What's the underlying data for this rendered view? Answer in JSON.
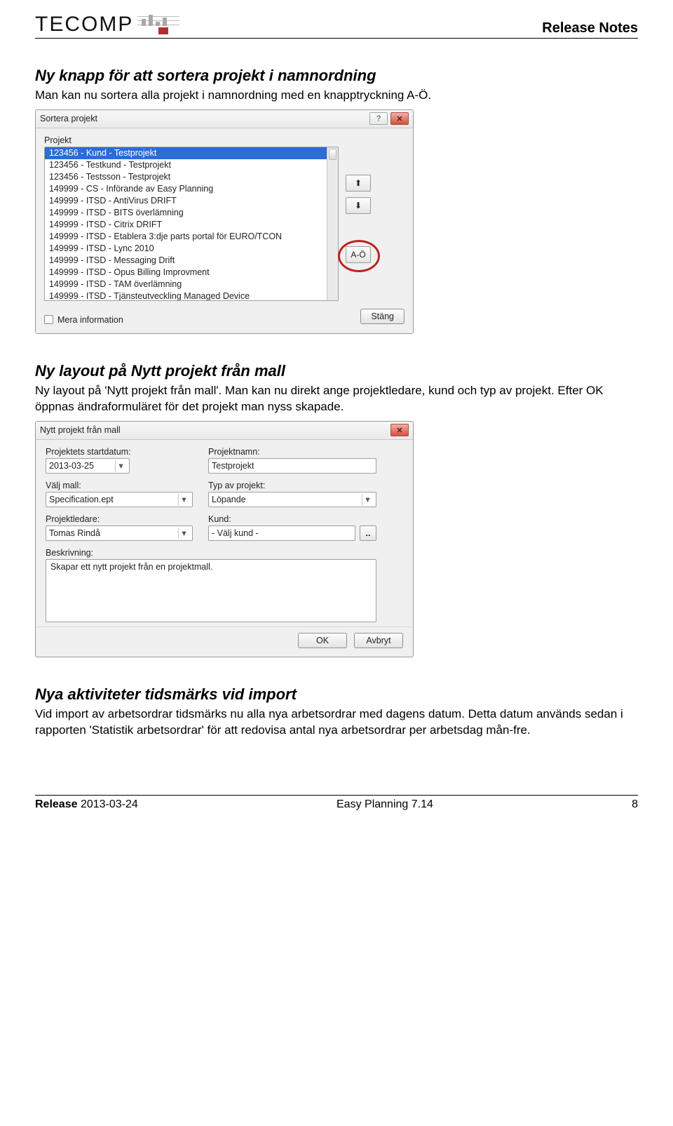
{
  "header": {
    "logo_text": "TECOMP",
    "release_notes": "Release Notes"
  },
  "sections": {
    "s1": {
      "title": "Ny knapp för att sortera projekt i namnordning",
      "body": "Man kan nu sortera alla projekt i namnordning med en knapptryckning A-Ö."
    },
    "s2": {
      "title": "Ny layout på Nytt projekt från mall",
      "body": "Ny layout på 'Nytt projekt från mall'. Man kan nu direkt ange projektledare, kund och typ av projekt. Efter OK öppnas ändraformuläret för det projekt man nyss skapade."
    },
    "s3": {
      "title": "Nya aktiviteter tidsmärks vid import",
      "body": "Vid import av arbetsordrar tidsmärks nu alla nya arbetsordrar med dagens datum. Detta datum används sedan i rapporten 'Statistik arbetsordrar' för att redovisa antal nya arbetsordrar per arbetsdag mån-fre."
    }
  },
  "sort_dialog": {
    "title": "Sortera projekt",
    "group_label": "Projekt",
    "items": [
      "123456 - Kund - Testprojekt",
      "123456 - Testkund - Testprojekt",
      "123456 - Testsson - Testprojekt",
      "149999 - CS - Införande av Easy Planning",
      "149999 - ITSD - AntiVirus DRIFT",
      "149999 - ITSD - BITS överlämning",
      "149999 - ITSD - Citrix DRIFT",
      "149999 - ITSD - Etablera 3:dje parts portal för EURO/TCON",
      "149999 - ITSD - Lync 2010",
      "149999 - ITSD - Messaging Drift",
      "149999 - ITSD - Opus Billing Improvment",
      "149999 - ITSD - TAM överlämning",
      "149999 - ITSD - Tjänsteutveckling Managed Device"
    ],
    "btn_up": "⬆",
    "btn_down": "⬇",
    "btn_azo": "A-Ö",
    "chk_more_info": "Mera information",
    "btn_close": "Stäng",
    "help_icon": "?",
    "close_icon": "✕"
  },
  "new_project_dialog": {
    "title": "Nytt projekt från mall",
    "close_icon": "✕",
    "fields": {
      "start_label": "Projektets startdatum:",
      "start_value": "2013-03-25",
      "name_label": "Projektnamn:",
      "name_value": "Testprojekt",
      "mall_label": "Välj mall:",
      "mall_value": "Specification.ept",
      "typ_label": "Typ av projekt:",
      "typ_value": "Löpande",
      "ledare_label": "Projektledare:",
      "ledare_value": "Tomas Rindå",
      "kund_label": "Kund:",
      "kund_value": "- Välj kund -",
      "besk_label": "Beskrivning:",
      "besk_value": "Skapar ett nytt projekt från en projektmall."
    },
    "btn_ok": "OK",
    "btn_cancel": "Avbryt",
    "dotdot": ".."
  },
  "footer": {
    "release_label": "Release",
    "release_date": "2013-03-24",
    "product": "Easy Planning 7.14",
    "page": "8"
  }
}
